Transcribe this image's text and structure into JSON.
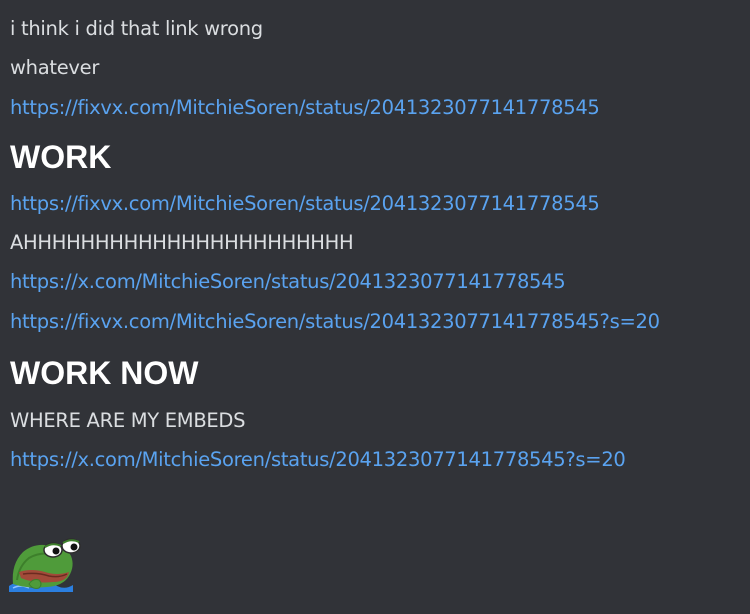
{
  "messages": [
    {
      "kind": "text",
      "content": "i think i did that link wrong"
    },
    {
      "kind": "text",
      "content": "whatever"
    },
    {
      "kind": "link",
      "content": "https://fixvx.com/MitchieSoren/status/2041323077141778545"
    },
    {
      "kind": "heading",
      "content": "WORK"
    },
    {
      "kind": "link",
      "content": "https://fixvx.com/MitchieSoren/status/2041323077141778545"
    },
    {
      "kind": "text",
      "content": "AHHHHHHHHHHHHHHHHHHHHHHH"
    },
    {
      "kind": "link",
      "content": "https://x.com/MitchieSoren/status/2041323077141778545"
    },
    {
      "kind": "link",
      "content": "https://fixvx.com/MitchieSoren/status/2041323077141778545?s=20"
    },
    {
      "kind": "heading",
      "content": "WORK NOW"
    },
    {
      "kind": "text",
      "content": "WHERE ARE MY EMBEDS"
    },
    {
      "kind": "link",
      "content": "https://x.com/MitchieSoren/status/2041323077141778545?s=20"
    }
  ],
  "emoji": {
    "icon": "peepo-frog-emoji-icon"
  },
  "colors": {
    "background": "#313338",
    "text": "#dbdee1",
    "link": "#5aa3f0",
    "heading": "#ffffff"
  }
}
